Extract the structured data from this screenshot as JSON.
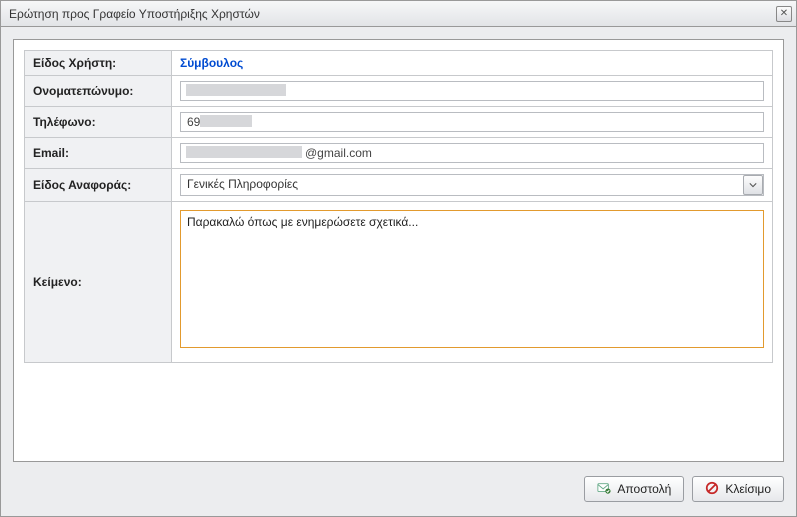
{
  "titlebar": {
    "title": "Ερώτηση προς Γραφείο Υποστήριξης Χρηστών"
  },
  "labels": {
    "usertype": "Είδος Χρήστη:",
    "fullname": "Ονοματεπώνυμο:",
    "phone": "Τηλέφωνο:",
    "email": "Email:",
    "reporttype": "Είδος Αναφοράς:",
    "text": "Κείμενο:"
  },
  "values": {
    "usertype": "Σύμβουλος",
    "fullname": "",
    "phone": "69",
    "email": "@gmail.com",
    "reporttype": "Γενικές Πληροφορίες",
    "text": "Παρακαλώ όπως με ενημερώσετε σχετικά..."
  },
  "buttons": {
    "send": "Αποστολή",
    "close": "Κλείσιμο"
  }
}
